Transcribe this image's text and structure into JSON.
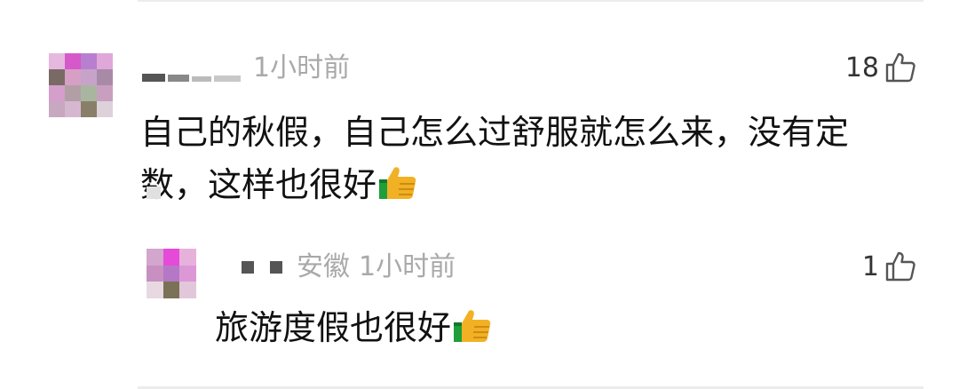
{
  "main_comment": {
    "time": "1小时前",
    "likes": "18",
    "text": "自己的秋假，自己怎么过舒服就怎么来，没有定数，这样也很好",
    "avatar_colors": [
      "#e6b7df",
      "#d659c9",
      "#b87fcf",
      "#dfa8d9",
      "#7a6a66",
      "#d5a0c4",
      "#c7a3c9",
      "#a88aa7",
      "#d59ecb",
      "#b29fa6",
      "#aab5a0",
      "#c89fbf",
      "#c7a8c0",
      "#d6b7d0",
      "#897f68",
      "#ddd2da"
    ]
  },
  "reply": {
    "location": "安徽",
    "time": "1小时前",
    "likes": "1",
    "text": "旅游度假也很好",
    "avatar_colors": [
      "#d3a6cd",
      "#e64ad9",
      "#e6b2dc",
      "#c790c0",
      "#b478c6",
      "#dc98d6",
      "#e8d8e2",
      "#7b7157",
      "#e2c7da"
    ]
  },
  "icons": {
    "like": "thumbs-up-outline-icon",
    "emoji": "thumbs-up-emoji-icon"
  },
  "colors": {
    "meta_text": "#a9a9a9",
    "body_text": "#111111",
    "divider": "#ececec"
  }
}
